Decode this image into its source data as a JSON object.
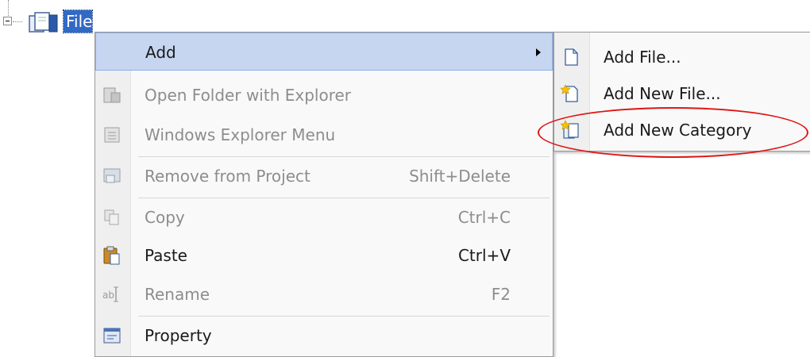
{
  "tree": {
    "node_label": "File"
  },
  "context_menu": {
    "items": [
      {
        "label": "Add",
        "shortcut": "",
        "icon": "none",
        "state": "highlighted",
        "has_submenu": true
      },
      {
        "label": "Open Folder with Explorer",
        "shortcut": "",
        "icon": "folder-explorer-icon",
        "state": "disabled"
      },
      {
        "label": "Windows Explorer Menu",
        "shortcut": "",
        "icon": "explorer-menu-icon",
        "state": "disabled"
      },
      {
        "label": "Remove from Project",
        "shortcut": "Shift+Delete",
        "icon": "remove-icon",
        "state": "disabled"
      },
      {
        "label": "Copy",
        "shortcut": "Ctrl+C",
        "icon": "copy-icon",
        "state": "disabled"
      },
      {
        "label": "Paste",
        "shortcut": "Ctrl+V",
        "icon": "paste-icon",
        "state": "enabled"
      },
      {
        "label": "Rename",
        "shortcut": "F2",
        "icon": "rename-icon",
        "state": "disabled"
      },
      {
        "label": "Property",
        "shortcut": "",
        "icon": "property-icon",
        "state": "enabled"
      }
    ]
  },
  "add_submenu": {
    "items": [
      {
        "label": "Add File...",
        "icon": "add-file-icon"
      },
      {
        "label": "Add New File...",
        "icon": "add-new-file-icon"
      },
      {
        "label": "Add New Category",
        "icon": "add-new-category-icon"
      }
    ]
  },
  "colors": {
    "selection": "#3169c6",
    "menu_highlight": "#c6d6f1",
    "annotation": "#e01515"
  }
}
